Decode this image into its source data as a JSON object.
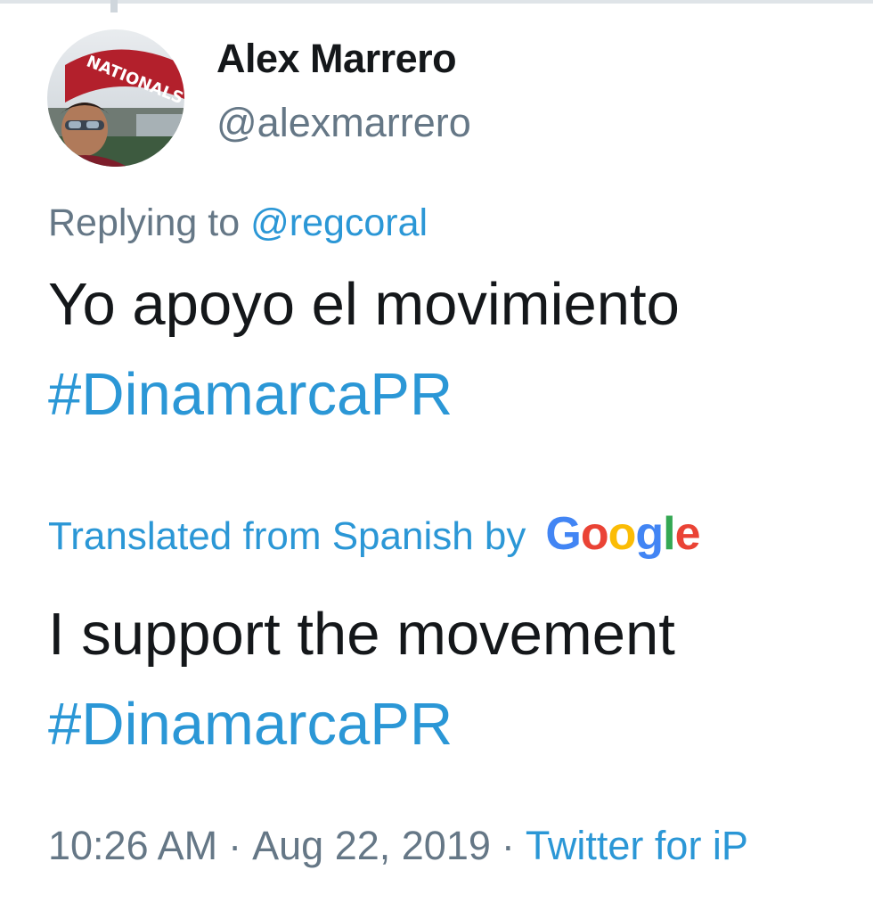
{
  "tweet": {
    "author": {
      "display_name": "Alex Marrero",
      "handle": "@alexmarrero",
      "avatar_sign_text": "NATIONALS"
    },
    "reply": {
      "prefix": "Replying to",
      "mention": "@regcoral"
    },
    "original": {
      "line1": "Yo apoyo el movimiento",
      "hashtag": "#DinamarcaPR"
    },
    "translation": {
      "label": "Translated from Spanish by",
      "provider_letters": [
        "G",
        "o",
        "o",
        "g",
        "l",
        "e"
      ],
      "provider_colors": [
        "#4285f4",
        "#ea4335",
        "#fbbc05",
        "#4285f4",
        "#34a853",
        "#ea4335"
      ],
      "line1": "I support the movement",
      "hashtag": "#DinamarcaPR"
    },
    "meta": {
      "time": "10:26 AM",
      "separator": "·",
      "date": "Aug 22, 2019",
      "source": "Twitter for iP"
    }
  },
  "colors": {
    "link": "#2b97d6",
    "muted": "#657786",
    "text": "#14171a"
  }
}
